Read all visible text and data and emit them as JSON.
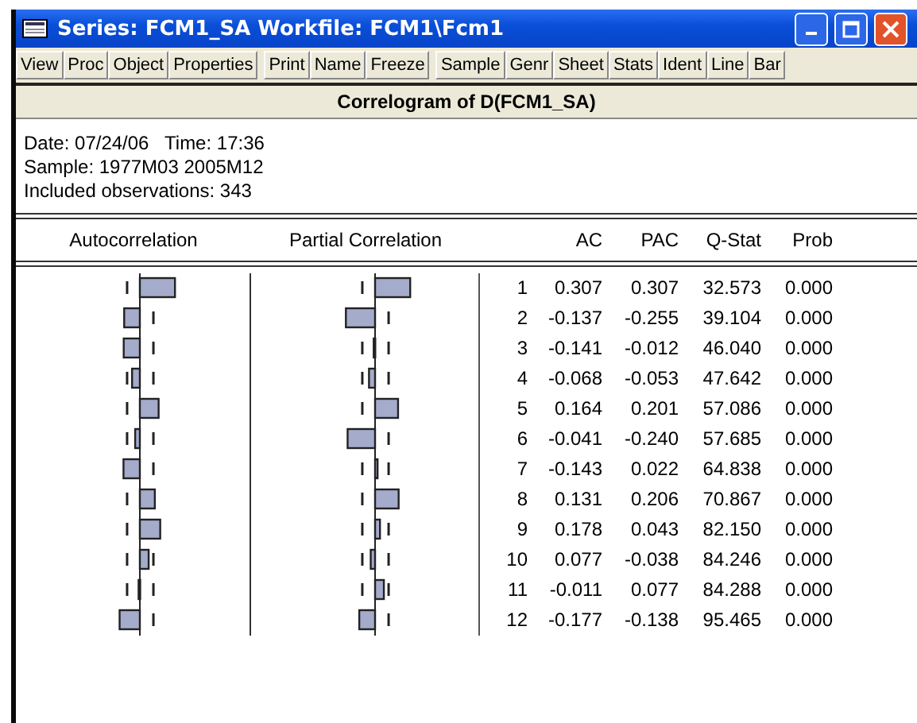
{
  "window": {
    "title": "Series: FCM1_SA   Workfile: FCM1\\Fcm1"
  },
  "toolbar": {
    "groups": [
      [
        "View",
        "Proc",
        "Object",
        "Properties"
      ],
      [
        "Print",
        "Name",
        "Freeze"
      ],
      [
        "Sample",
        "Genr",
        "Sheet",
        "Stats",
        "Ident",
        "Line",
        "Bar"
      ]
    ]
  },
  "view_title": "Correlogram of D(FCM1_SA)",
  "info": [
    "Date: 07/24/06   Time: 17:36",
    "Sample: 1977M03 2005M12",
    "Included observations: 343"
  ],
  "table": {
    "columns": [
      "Autocorrelation",
      "Partial Correlation",
      "",
      "AC",
      "PAC",
      "Q-Stat",
      "Prob"
    ],
    "rows": [
      {
        "lag": "1",
        "ac": "0.307",
        "pac": "0.307",
        "q": "32.573",
        "prob": "0.000"
      },
      {
        "lag": "2",
        "ac": "-0.137",
        "pac": "-0.255",
        "q": "39.104",
        "prob": "0.000"
      },
      {
        "lag": "3",
        "ac": "-0.141",
        "pac": "-0.012",
        "q": "46.040",
        "prob": "0.000"
      },
      {
        "lag": "4",
        "ac": "-0.068",
        "pac": "-0.053",
        "q": "47.642",
        "prob": "0.000"
      },
      {
        "lag": "5",
        "ac": "0.164",
        "pac": "0.201",
        "q": "57.086",
        "prob": "0.000"
      },
      {
        "lag": "6",
        "ac": "-0.041",
        "pac": "-0.240",
        "q": "57.685",
        "prob": "0.000"
      },
      {
        "lag": "7",
        "ac": "-0.143",
        "pac": "0.022",
        "q": "64.838",
        "prob": "0.000"
      },
      {
        "lag": "8",
        "ac": "0.131",
        "pac": "0.206",
        "q": "70.867",
        "prob": "0.000"
      },
      {
        "lag": "9",
        "ac": "0.178",
        "pac": "0.043",
        "q": "82.150",
        "prob": "0.000"
      },
      {
        "lag": "10",
        "ac": "0.077",
        "pac": "-0.038",
        "q": "84.246",
        "prob": "0.000"
      },
      {
        "lag": "11",
        "ac": "-0.011",
        "pac": "0.077",
        "q": "84.288",
        "prob": "0.000"
      },
      {
        "lag": "12",
        "ac": "-0.177",
        "pac": "-0.138",
        "q": "95.465",
        "prob": "0.000"
      }
    ]
  }
}
